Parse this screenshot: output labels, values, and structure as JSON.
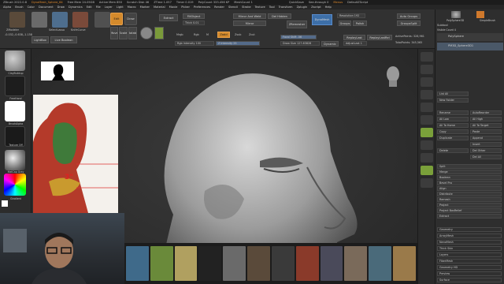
{
  "topbar": {
    "title": "ZBrush 2022.0.8",
    "doc": "DynaMesh_Sphere_64",
    "stats": [
      "Free Mem 24.05GB",
      "Active Mem 850",
      "Scratch Disk 46",
      "ZTime 1.057",
      "Timer 0.019",
      "PolyCount 333.456 KP",
      "MeshCount 1"
    ],
    "right_items": [
      "QuickSave",
      "See-through 0",
      "Menus",
      "DefaultZScript"
    ]
  },
  "menus": [
    "Alpha",
    "Brush",
    "Color",
    "Document",
    "Draw",
    "Dynamics",
    "Edit",
    "File",
    "Layer",
    "Light",
    "Macro",
    "Marker",
    "Material",
    "Movie",
    "Picker",
    "Preferences",
    "Render",
    "Stencil",
    "Stroke",
    "Texture",
    "Tool",
    "Transform",
    "Zplugin",
    "Zscript",
    "Help"
  ],
  "shelf": {
    "tools": [
      "ZModeler",
      "SelectLasso",
      "SelectRect",
      "KnifeCurve"
    ],
    "left_buttons": [
      "LightBox",
      "Live Boolean"
    ],
    "modes": [
      "Edit",
      "Draw",
      "Move",
      "Scale",
      "Rotate"
    ],
    "mrgb": [
      "Mrgb",
      "Rgb",
      "M",
      "Zadd",
      "Zsub",
      "Zcut"
    ],
    "rgb_intensity": "Rgb Intensity 100",
    "z_intensity": "Z Intensity 25",
    "focal_shift": "Focal Shift -56",
    "draw_size": "Draw Size 127.63828",
    "dynamic": "Dynamic",
    "extract": "Extract",
    "thick": "Thick 0.01",
    "fillobject": "FillObject",
    "mirror_weld": "Mirror And Weld",
    "del_hidden": "Del Hidden",
    "mirror": "Mirror",
    "zremesher": "ZRemesher",
    "dynamesh": "DynaMesh",
    "resolution": "Resolution 192",
    "auto_groups": "Auto Groups",
    "groups": "Groups",
    "polish": "Polish",
    "group_split": "GroupsSplit",
    "replay_last": "ReplayLast",
    "replay_last_rel": "ReplayLastRel",
    "adjust_last": "AdjustLast 1",
    "active_points": "ActivePoints: 328,961",
    "total_points": "TotalPoints: 345,565",
    "coords": "-0.032,-0.638,-1.158"
  },
  "left_panel": {
    "materials": [
      "ClayBuildup",
      "FreeHand",
      "BrushAlpha",
      "Texture Off",
      "MatCap Gray"
    ],
    "gradient": "Gradient",
    "switch_color": "SwitchColor",
    "alternate": "Alternate"
  },
  "reference": {
    "size_label": "3\""
  },
  "right_shelf": [
    "Persp",
    "Floor",
    "Local",
    "Frame",
    "Move",
    "Scale",
    "Rotate",
    "PolyF",
    "Transp",
    "Solo",
    "Xpose"
  ],
  "tray": {
    "header": [
      "PolySphere3D",
      "PolySphereSD",
      "SimpleBrush"
    ],
    "subtool_title": "Subtool",
    "visible_count": "Visible Count 4",
    "subtools": [
      "PolySphere",
      "PM3D_Sphere3D1"
    ],
    "list_all": "List All",
    "new_folder": "New Folder",
    "buttons_left": [
      "Rename",
      "All Low",
      "All To Home",
      "Copy",
      "Duplicate",
      "Append",
      "Delete",
      "Split",
      "Merge",
      "Boolean",
      "Bevel Pro",
      "Align",
      "Distribute",
      "Remesh",
      "Project",
      "Project BasRelief",
      "Extract"
    ],
    "buttons_right": [
      "AutoReorder",
      "All High",
      "All To Target",
      "Paste",
      "Insert",
      "Del Other",
      "Del All"
    ],
    "sections": [
      "Geometry",
      "ArrayMesh",
      "NanoMesh",
      "Thick Skin",
      "Layers",
      "FiberMesh",
      "Geometry HD",
      "Preview",
      "Surface"
    ]
  }
}
